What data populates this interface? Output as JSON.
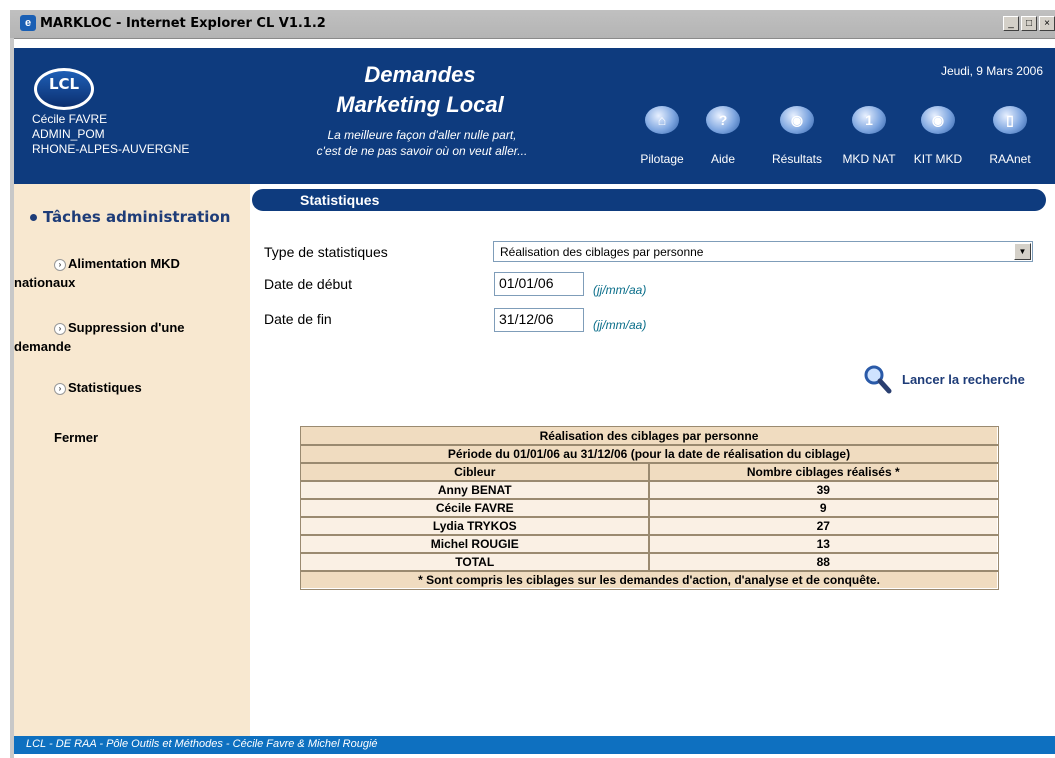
{
  "window": {
    "title": "MARKLOC - Internet Explorer CL V1.1.2"
  },
  "header": {
    "logo_text": "LCL",
    "user_name": "Cécile FAVRE",
    "user_role": "ADMIN_POM",
    "user_region": "RHONE-ALPES-AUVERGNE",
    "app_title_line1": "Demandes",
    "app_title_line2": "Marketing Local",
    "tagline_line1": "La meilleure façon d'aller nulle part,",
    "tagline_line2": "c'est de ne pas savoir où on veut aller...",
    "date": "Jeudi, 9 Mars 2006",
    "nav": [
      {
        "label": "Pilotage",
        "icon": "house-icon"
      },
      {
        "label": "Aide",
        "icon": "help-icon"
      },
      {
        "label": "Résultats",
        "icon": "eye-icon"
      },
      {
        "label": "MKD NAT",
        "icon": "document-icon"
      },
      {
        "label": "KIT MKD",
        "icon": "eye-icon"
      },
      {
        "label": "RAAnet",
        "icon": "door-icon"
      }
    ]
  },
  "sidebar": {
    "heading": "Tâches administration",
    "items": [
      {
        "label_line1": "Alimentation MKD",
        "label_line2": "nationaux"
      },
      {
        "label_line1": "Suppression d'une",
        "label_line2": "demande"
      },
      {
        "label_line1": "Statistiques"
      }
    ],
    "close_label": "Fermer"
  },
  "main": {
    "section_title": "Statistiques",
    "type_label": "Type de statistiques",
    "type_value": "Réalisation des ciblages par personne",
    "start_label": "Date de début",
    "start_value": "01/01/06",
    "end_label": "Date de fin",
    "end_value": "31/12/06",
    "date_hint": "(jj/mm/aa)",
    "search_label": "Lancer la recherche"
  },
  "results": {
    "title": "Réalisation des ciblages par personne",
    "period": "Période du 01/01/06 au 31/12/06 (pour la date de réalisation du ciblage)",
    "columns": [
      "Cibleur",
      "Nombre ciblages réalisés *"
    ],
    "rows": [
      [
        "Anny BENAT",
        "39"
      ],
      [
        "Cécile FAVRE",
        "9"
      ],
      [
        "Lydia TRYKOS",
        "27"
      ],
      [
        "Michel ROUGIE",
        "13"
      ],
      [
        "TOTAL",
        "88"
      ]
    ],
    "footnote": "* Sont compris les ciblages sur les demandes d'action, d'analyse et de conquête."
  },
  "footer": {
    "text": "LCL - DE RAA - Pôle Outils et Méthodes - Cécile Favre & Michel Rougié"
  },
  "colors": {
    "banner": "#0e3b7e",
    "sidebar": "#f8e8d0",
    "footer": "#0e70c0",
    "table_header": "#f0dcc0"
  }
}
